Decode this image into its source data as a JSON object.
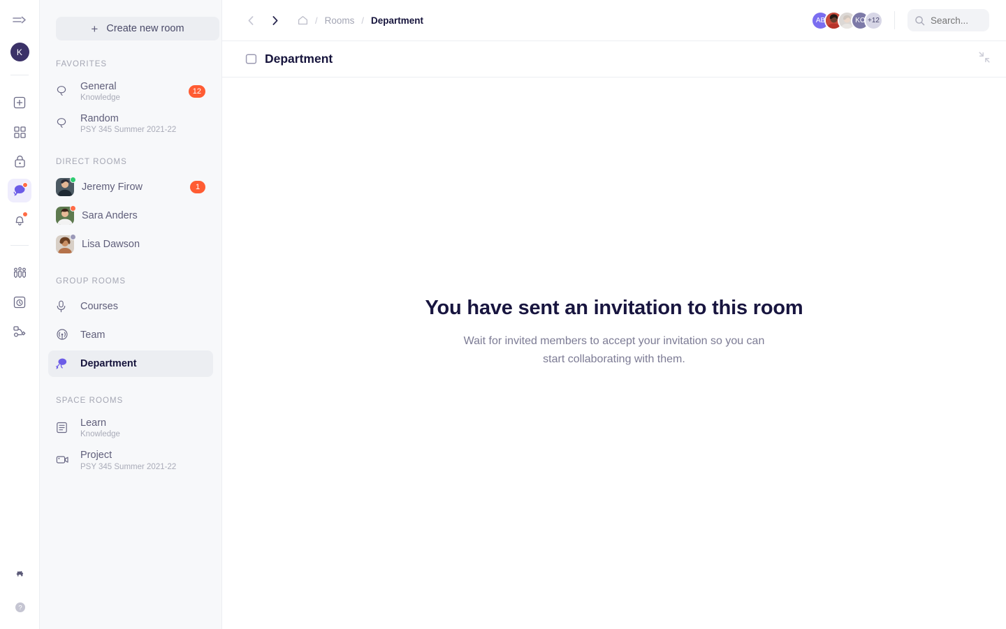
{
  "colors": {
    "accent": "#6c5ce7",
    "badge": "#ff5c33",
    "sidebar_bg": "#f7f8fa",
    "text_dark": "#16143c",
    "text_muted": "#a4a6b3",
    "online": "#2ecc71",
    "busy": "#ff6b45",
    "offline": "#9b99b8"
  },
  "rail": {
    "toggle_icon": "menu-expand-icon",
    "avatar_initial": "K",
    "items": [
      {
        "name": "add-icon",
        "icon": "plus-square-icon",
        "active": false,
        "dot": false
      },
      {
        "name": "apps-icon",
        "icon": "grid-icon",
        "active": false,
        "dot": false
      },
      {
        "name": "lock-icon",
        "icon": "lock-icon",
        "active": false,
        "dot": false
      },
      {
        "name": "chat-icon",
        "icon": "chat-bubbles-icon",
        "active": true,
        "dot": true
      },
      {
        "name": "notifications-icon",
        "icon": "bell-icon",
        "active": false,
        "dot": true
      }
    ],
    "items_lower": [
      {
        "name": "people-icon",
        "icon": "people-group-icon",
        "active": false,
        "dot": false
      },
      {
        "name": "history-icon",
        "icon": "clock-box-icon",
        "active": false,
        "dot": false
      },
      {
        "name": "workflow-icon",
        "icon": "flow-nodes-icon",
        "active": false,
        "dot": false
      }
    ],
    "bottom": [
      {
        "name": "settings-icon",
        "icon": "gear-icon"
      },
      {
        "name": "help-icon",
        "icon": "question-circle-icon"
      }
    ]
  },
  "sidebar": {
    "create_button": {
      "label": "Create new room",
      "icon": "plus-icon"
    },
    "sections": [
      {
        "title": "FAVORITES",
        "type": "rooms",
        "items": [
          {
            "name": "General",
            "sub": "Knowledge",
            "icon": "chat-bubble-outline-icon",
            "badge": "12",
            "active": false
          },
          {
            "name": "Random",
            "sub": "PSY 345 Summer 2021-22",
            "icon": "chat-bubble-outline-icon",
            "badge": "",
            "active": false
          }
        ]
      },
      {
        "title": "DIRECT ROOMS",
        "type": "direct",
        "items": [
          {
            "name": "Jeremy Firow",
            "sub": "",
            "status": "online",
            "badge": "1",
            "active": false
          },
          {
            "name": "Sara Anders",
            "sub": "",
            "status": "busy",
            "badge": "",
            "active": false
          },
          {
            "name": "Lisa Dawson",
            "sub": "",
            "status": "offline",
            "badge": "",
            "active": false
          }
        ]
      },
      {
        "title": "GROUP ROOMS",
        "type": "rooms",
        "items": [
          {
            "name": "Courses",
            "sub": "",
            "icon": "microphone-icon",
            "badge": "",
            "active": false
          },
          {
            "name": "Team",
            "sub": "",
            "icon": "broadcast-icon",
            "badge": "",
            "active": false
          },
          {
            "name": "Department",
            "sub": "",
            "icon": "chat-bubbles-filled-icon",
            "badge": "",
            "active": true
          }
        ]
      },
      {
        "title": "SPACE ROOMS",
        "type": "rooms",
        "items": [
          {
            "name": "Learn",
            "sub": "Knowledge",
            "icon": "document-list-icon",
            "badge": "",
            "active": false
          },
          {
            "name": "Project",
            "sub": "PSY 345 Summer 2021-22",
            "icon": "video-camera-icon",
            "badge": "",
            "active": false
          }
        ]
      }
    ]
  },
  "topbar": {
    "back_icon": "chevron-left-icon",
    "forward_icon": "chevron-right-icon",
    "breadcrumb": {
      "home_icon": "home-icon",
      "separator": "/",
      "items": [
        {
          "label": "Rooms",
          "current": false
        },
        {
          "label": "Department",
          "current": true
        }
      ]
    },
    "avatars": [
      {
        "label": "AB",
        "type": "initials",
        "color": "#7b6ef0"
      },
      {
        "label": "",
        "type": "photo",
        "color": "#8a5a45"
      },
      {
        "label": "",
        "type": "photo",
        "color": "#d9d4d0"
      },
      {
        "label": "KO",
        "type": "initials",
        "color": "#7d7aa8"
      },
      {
        "label": "+12",
        "type": "count",
        "color": "#d7d6e6"
      }
    ],
    "search": {
      "placeholder": "Search...",
      "value": "",
      "icon": "search-icon"
    }
  },
  "room_header": {
    "icon": "room-square-icon",
    "title": "Department",
    "collapse_icon": "collapse-diagonal-icon"
  },
  "empty_state": {
    "heading": "You have sent an invitation to this room",
    "body": "Wait for invited members to accept your invitation so you can start collaborating with them."
  }
}
